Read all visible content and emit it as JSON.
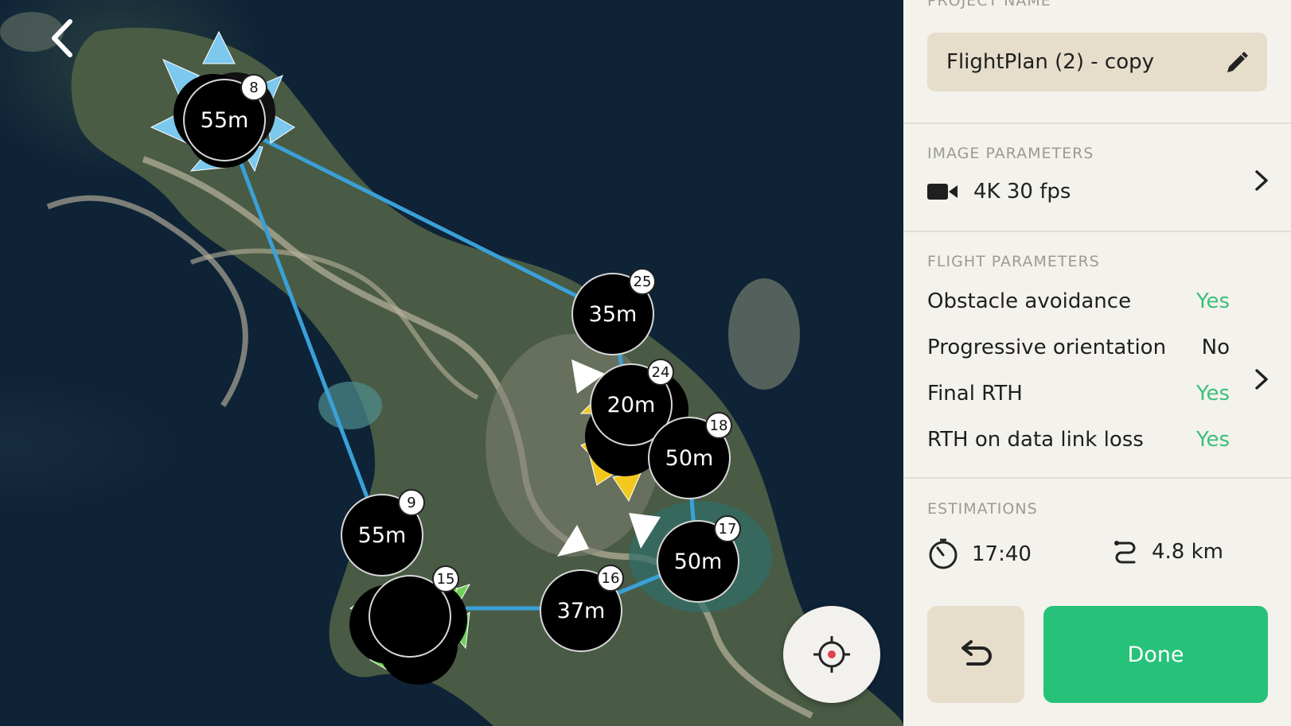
{
  "panel": {
    "project_name_title": "PROJECT NAME",
    "project_name_value": "FlightPlan (2) - copy",
    "image_parameters_title": "IMAGE PARAMETERS",
    "video_mode": "4K 30 fps",
    "flight_parameters_title": "FLIGHT PARAMETERS",
    "flight_params": [
      {
        "label": "Obstacle avoidance",
        "value": "Yes"
      },
      {
        "label": "Progressive orientation",
        "value": "No"
      },
      {
        "label": "Final RTH",
        "value": "Yes"
      },
      {
        "label": "RTH on data link loss",
        "value": "Yes"
      }
    ],
    "estimations_title": "ESTIMATIONS",
    "duration": "17:40",
    "distance": "4.8 km",
    "done_label": "Done"
  },
  "map": {
    "waypoints": [
      {
        "altitude": "55m",
        "number": "8"
      },
      {
        "altitude": "35m",
        "number": "25"
      },
      {
        "altitude": "20m",
        "number": "24"
      },
      {
        "altitude": "50m",
        "number": "18"
      },
      {
        "altitude": "50m",
        "number": "17"
      },
      {
        "altitude": "37m",
        "number": "16"
      },
      {
        "altitude": "55m",
        "number": "9"
      },
      {
        "altitude": "",
        "number": "15"
      }
    ]
  },
  "colors": {
    "accent_green": "#27c27a",
    "yes_green": "#3dbf7b",
    "path_blue": "#3aa0d8",
    "marker_blue": "#7cc8ee",
    "marker_yellow": "#f2c81e",
    "marker_green": "#6fcf5a",
    "panel_bg": "#f4f2ec",
    "field_bg": "#e6ddcb"
  },
  "icons": [
    "back-icon",
    "locate-icon",
    "pencil-icon",
    "video-camera-icon",
    "chevron-right-icon",
    "timer-icon",
    "route-icon",
    "undo-icon"
  ]
}
